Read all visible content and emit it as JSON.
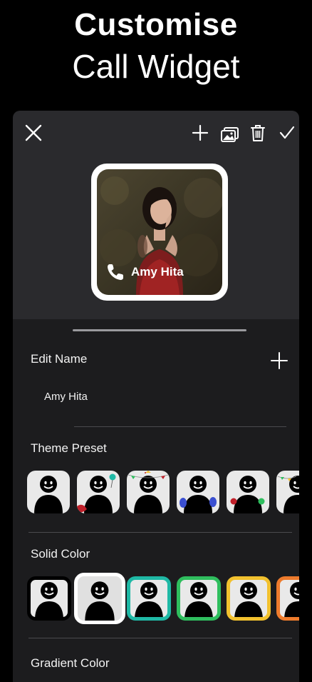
{
  "hero": {
    "title": "Customise",
    "subtitle": "Call Widget"
  },
  "toolbar": {
    "icons": [
      "close-icon",
      "add-icon",
      "gallery-icon",
      "trash-icon",
      "check-icon"
    ]
  },
  "widget": {
    "name": "Amy Hita",
    "frame_color": "#ffffff"
  },
  "edit_name": {
    "label": "Edit Name",
    "value": "Amy Hita"
  },
  "theme_preset": {
    "label": "Theme Preset",
    "items": [
      "plain",
      "balloon",
      "garland-party",
      "blue-balloons",
      "red-green-balloons",
      "garland"
    ]
  },
  "solid_color": {
    "label": "Solid Color",
    "colors": [
      "#000000",
      "#ffffff",
      "#1fb9a6",
      "#2fbe5e",
      "#f2c12e",
      "#ee7b2c"
    ]
  },
  "gradient_color": {
    "label": "Gradient Color"
  },
  "colors": {
    "background": "#000000",
    "sheet": "#2a2a2d",
    "panel": "#1c1c1e",
    "avatar_tile": "#e9e9e9"
  }
}
